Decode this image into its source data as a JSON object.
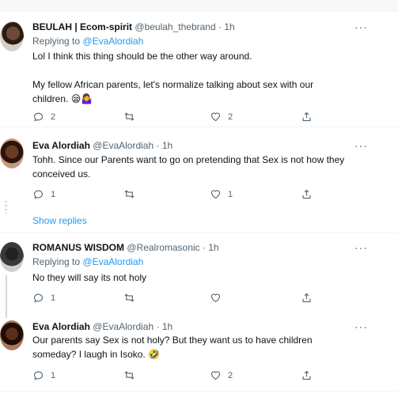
{
  "tweets": [
    {
      "name": "BEULAH | Ecom-spirit",
      "handle": "@beulah_thebrand",
      "time": "· 1h",
      "replying_prefix": "Replying to",
      "replying_handle": "@EvaAlordiah",
      "text_lines": [
        "Lol I think this thing should be the other way around.",
        "",
        "My fellow African parents, let's normalize talking about sex with our",
        "children. 😪🤷‍♀️"
      ],
      "reply_count": "2",
      "retweet_count": "",
      "like_count": "2"
    },
    {
      "name": "Eva Alordiah",
      "handle": "@EvaAlordiah",
      "time": "· 1h",
      "text_lines": [
        "Tohh. Since our Parents want to go on pretending that Sex is not how they",
        "conceived us."
      ],
      "reply_count": "1",
      "retweet_count": "",
      "like_count": "1"
    },
    {
      "name": "ROMANUS WISDOM",
      "handle": "@Realromasonic",
      "time": "· 1h",
      "replying_prefix": "Replying to",
      "replying_handle": "@EvaAlordiah",
      "text_lines": [
        "No they will say its not holy"
      ],
      "reply_count": "1",
      "retweet_count": "",
      "like_count": ""
    },
    {
      "name": "Eva Alordiah",
      "handle": "@EvaAlordiah",
      "time": "· 1h",
      "text_lines": [
        "Our parents say Sex is not holy? But they want us to have children",
        "someday? I laugh in Isoko. 🤣"
      ],
      "reply_count": "1",
      "retweet_count": "",
      "like_count": "2"
    }
  ],
  "show_replies": "Show replies",
  "more_label": "···",
  "icons": {
    "reply": "reply-icon",
    "retweet": "retweet-icon",
    "like": "like-icon",
    "share": "share-icon",
    "more": "more-icon"
  },
  "colors": {
    "link": "#1d9bf0",
    "secondary_text": "#536471",
    "divider": "#eff3f4"
  }
}
